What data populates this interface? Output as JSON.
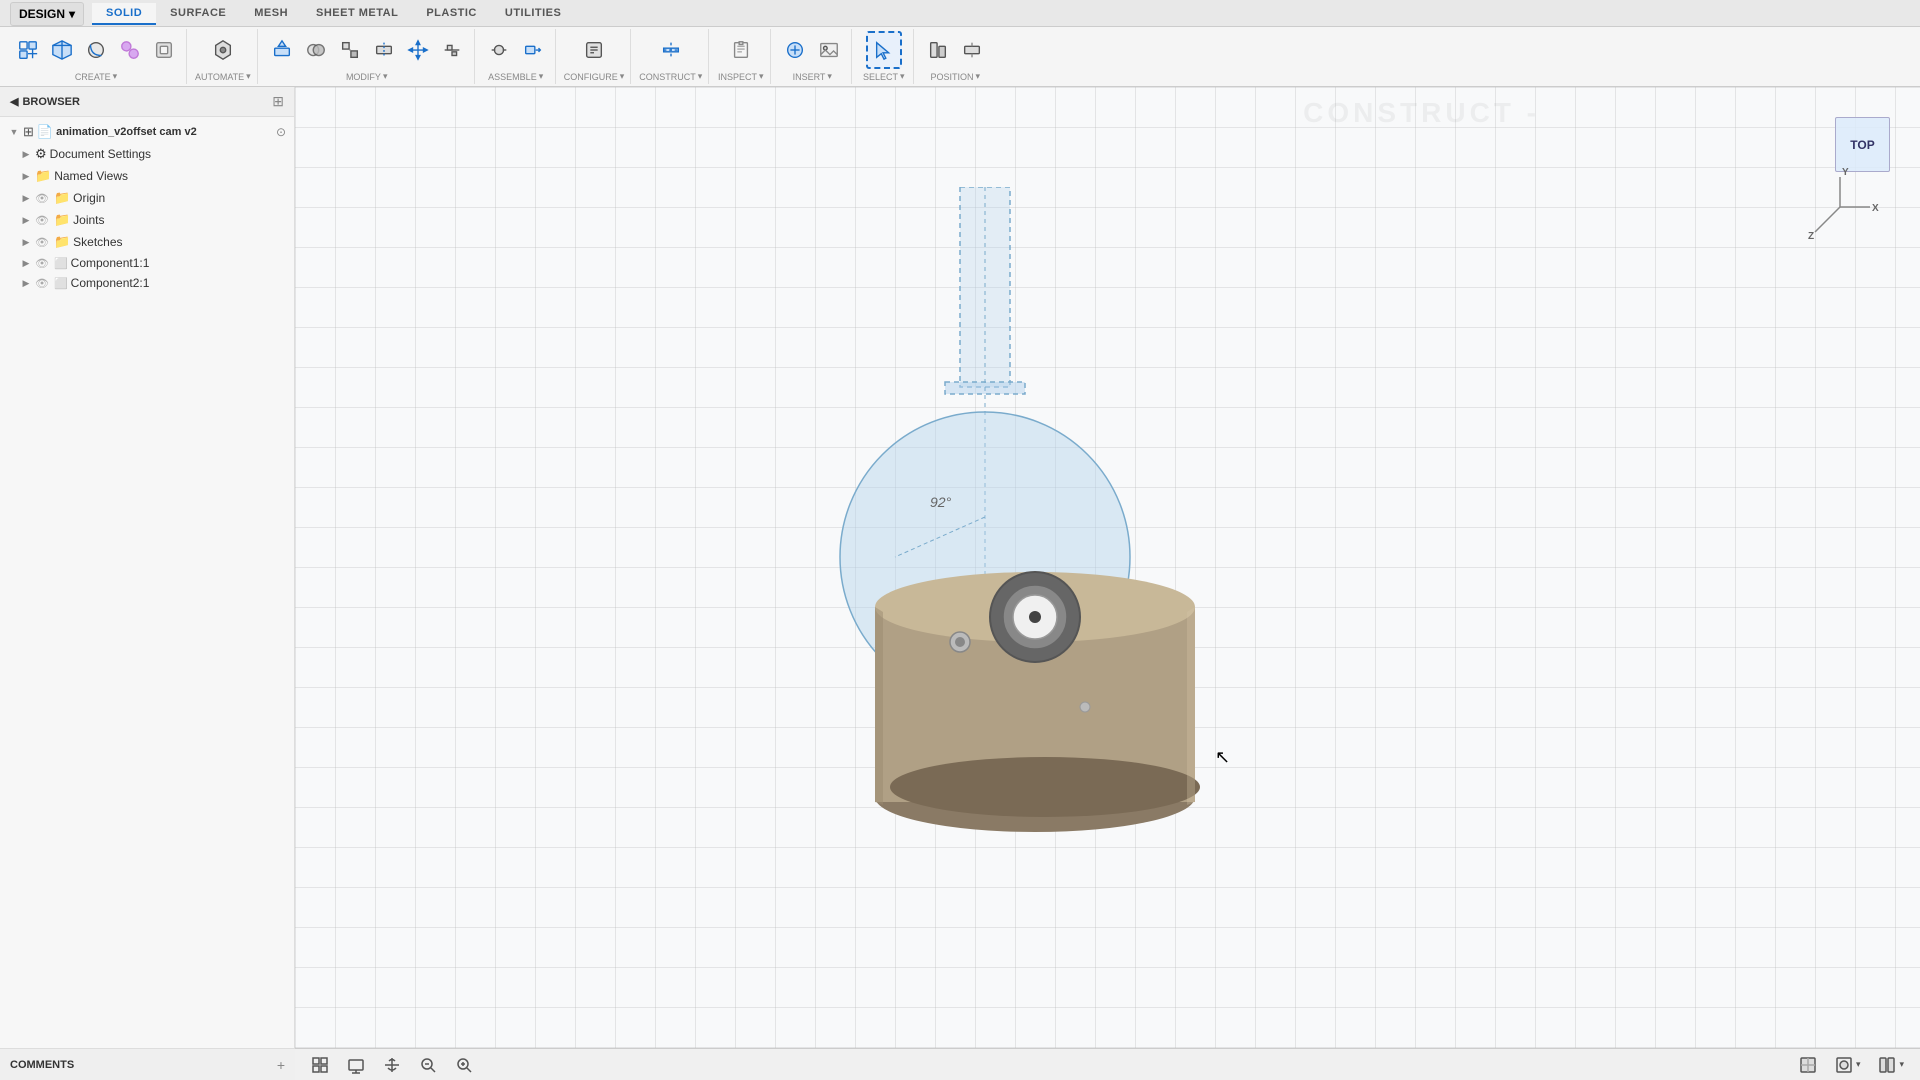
{
  "app": {
    "design_label": "DESIGN",
    "design_dropdown": "▾"
  },
  "tabs": [
    {
      "label": "SOLID",
      "active": true
    },
    {
      "label": "SURFACE",
      "active": false
    },
    {
      "label": "MESH",
      "active": false
    },
    {
      "label": "SHEET METAL",
      "active": false
    },
    {
      "label": "PLASTIC",
      "active": false
    },
    {
      "label": "UTILITIES",
      "active": false
    }
  ],
  "toolbar_sections": [
    {
      "label": "CREATE",
      "has_dropdown": true,
      "tools": [
        "new-component",
        "box",
        "fillet",
        "mirror",
        "pattern",
        "shell"
      ]
    },
    {
      "label": "AUTOMATE",
      "has_dropdown": true,
      "tools": [
        "automate"
      ]
    },
    {
      "label": "MODIFY",
      "has_dropdown": true,
      "tools": [
        "press-pull",
        "combine",
        "scale",
        "split",
        "move",
        "align"
      ]
    },
    {
      "label": "ASSEMBLE",
      "has_dropdown": true,
      "tools": [
        "joint",
        "move-component"
      ]
    },
    {
      "label": "CONFIGURE",
      "has_dropdown": true,
      "tools": [
        "configure"
      ]
    },
    {
      "label": "CONSTRUCT",
      "has_dropdown": true,
      "tools": [
        "construct"
      ]
    },
    {
      "label": "INSPECT",
      "has_dropdown": true,
      "tools": [
        "inspect"
      ]
    },
    {
      "label": "INSERT",
      "has_dropdown": true,
      "tools": [
        "insert"
      ]
    },
    {
      "label": "SELECT",
      "has_dropdown": true,
      "tools": [
        "select"
      ]
    },
    {
      "label": "POSITION",
      "has_dropdown": true,
      "tools": [
        "position"
      ]
    }
  ],
  "browser": {
    "title": "BROWSER",
    "collapse_icon": "◀",
    "pin_icon": "⊞"
  },
  "tree": {
    "root": {
      "label": "animation_v2offset cam v2",
      "icon": "📄",
      "expanded": true
    },
    "items": [
      {
        "label": "Document Settings",
        "icon": "⚙",
        "indent": 1,
        "has_eye": false,
        "has_box": false,
        "expanded": false
      },
      {
        "label": "Named Views",
        "icon": "📁",
        "indent": 1,
        "has_eye": false,
        "has_box": false,
        "expanded": false
      },
      {
        "label": "Origin",
        "icon": "📁",
        "indent": 1,
        "has_eye": true,
        "has_box": false,
        "expanded": false
      },
      {
        "label": "Joints",
        "icon": "📁",
        "indent": 1,
        "has_eye": true,
        "has_box": false,
        "expanded": false
      },
      {
        "label": "Sketches",
        "icon": "📁",
        "indent": 1,
        "has_eye": true,
        "has_box": false,
        "expanded": false
      },
      {
        "label": "Component1:1",
        "icon": "⬜",
        "indent": 1,
        "has_eye": true,
        "has_box": true,
        "expanded": false
      },
      {
        "label": "Component2:1",
        "icon": "⬜",
        "indent": 1,
        "has_eye": true,
        "has_box": true,
        "expanded": false
      }
    ]
  },
  "comments": {
    "label": "COMMENTS",
    "icon": "+"
  },
  "viewport": {
    "view_label": "TOP",
    "axis_x": "X",
    "axis_y": "Y",
    "axis_z": "Z",
    "angle_label": "92°",
    "construct_watermark": "CONSTRUCT -"
  },
  "bottom_bar": {
    "grid_icon": "⊞",
    "snap_icon": "⊕",
    "pan_icon": "✋",
    "zoom_out_icon": "🔍",
    "zoom_in_icon": "⊕",
    "view_mode_icon": "⬜",
    "display_icon": "⬜",
    "more_icon": "⬜"
  }
}
